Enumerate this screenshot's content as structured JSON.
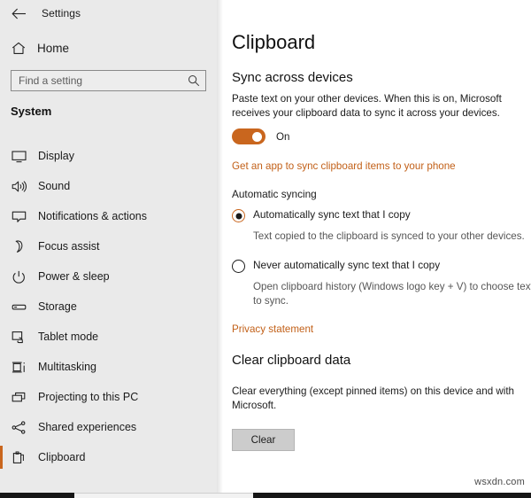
{
  "window": {
    "back_label": "back-arrow",
    "app_title": "Settings"
  },
  "sidebar": {
    "home_label": "Home",
    "search": {
      "placeholder": "Find a setting",
      "value": ""
    },
    "section_title": "System",
    "items": [
      {
        "label": "Display",
        "icon": "monitor-icon",
        "selected": false
      },
      {
        "label": "Sound",
        "icon": "speaker-icon",
        "selected": false
      },
      {
        "label": "Notifications & actions",
        "icon": "notification-icon",
        "selected": false
      },
      {
        "label": "Focus assist",
        "icon": "moon-icon",
        "selected": false
      },
      {
        "label": "Power & sleep",
        "icon": "power-icon",
        "selected": false
      },
      {
        "label": "Storage",
        "icon": "storage-icon",
        "selected": false
      },
      {
        "label": "Tablet mode",
        "icon": "tablet-icon",
        "selected": false
      },
      {
        "label": "Multitasking",
        "icon": "multitasking-icon",
        "selected": false
      },
      {
        "label": "Projecting to this PC",
        "icon": "projecting-icon",
        "selected": false
      },
      {
        "label": "Shared experiences",
        "icon": "share-icon",
        "selected": false
      },
      {
        "label": "Clipboard",
        "icon": "clipboard-icon",
        "selected": true
      }
    ]
  },
  "content": {
    "page_title": "Clipboard",
    "sync_section": {
      "heading": "Sync across devices",
      "description": "Paste text on your other devices. When this is on, Microsoft receives your clipboard data to sync it across your devices.",
      "toggle_state": "On",
      "toggle_on": true,
      "get_app_link": "Get an app to sync clipboard items to your phone",
      "automatic_syncing_label": "Automatic syncing",
      "options": [
        {
          "label": "Automatically sync text that I copy",
          "description": "Text copied to the clipboard is synced to your other devices.",
          "selected": true
        },
        {
          "label": "Never automatically sync text that I copy",
          "description": "Open clipboard history (Windows logo key + V) to choose text to sync.",
          "selected": false
        }
      ],
      "privacy_link": "Privacy statement"
    },
    "clear_section": {
      "heading": "Clear clipboard data",
      "description": "Clear everything (except pinned items) on this device and with Microsoft.",
      "button_label": "Clear"
    }
  },
  "watermark": "wsxdn.com",
  "colors": {
    "accent": "#c9661e",
    "accent_link": "#c26018",
    "sidebar_bg": "#eaeaea",
    "content_bg": "#ffffff",
    "text": "#1b1b1b",
    "muted_text": "#565656",
    "button_bg": "#cccccc"
  }
}
